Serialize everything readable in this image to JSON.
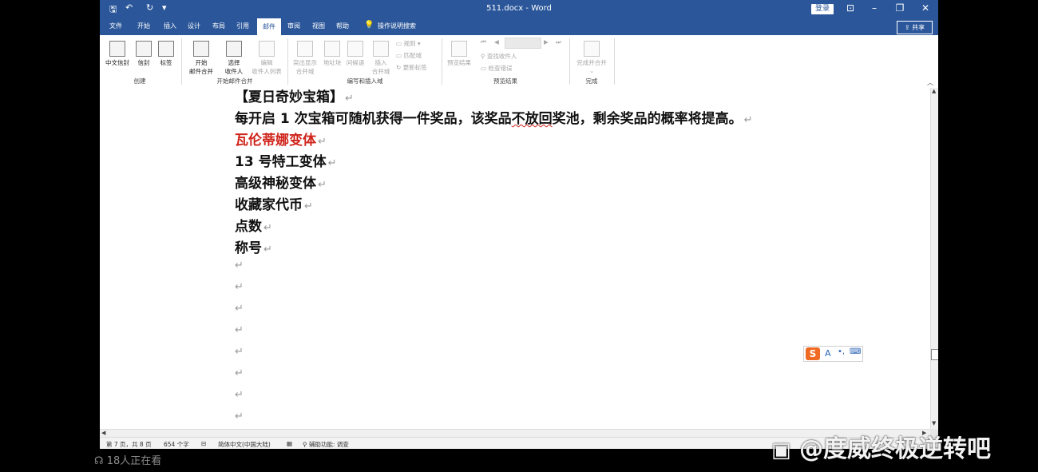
{
  "titlebar": {
    "doc_title": "511.docx - Word",
    "login": "登录",
    "qat_save": "🖫",
    "qat_undo": "↶",
    "qat_redo": "↻",
    "qat_more": "▾"
  },
  "tabs": [
    "文件",
    "开始",
    "插入",
    "设计",
    "布局",
    "引用",
    "邮件",
    "审阅",
    "视图",
    "帮助"
  ],
  "active_tab": "邮件",
  "tell_me": "操作说明搜索",
  "share": "共享",
  "ribbon": {
    "create": {
      "label": "创建",
      "envelope": "中文信封",
      "envelope2": "信封",
      "labels": "标签"
    },
    "start_merge": {
      "label": "开始邮件合并",
      "start": "开始",
      "start2": "邮件合并",
      "select": "选择",
      "select2": "收件人",
      "edit": "编辑",
      "edit2": "收件人列表"
    },
    "write_insert": {
      "label": "编写和插入域",
      "highlight": "突出显示",
      "highlight2": "合并域",
      "address": "地址块",
      "greeting": "问候语",
      "insert": "插入",
      "insert2": "合并域",
      "rules": "规则",
      "match": "匹配域",
      "update": "更新标签"
    },
    "preview": {
      "label": "预览结果",
      "preview_btn": "预览结果",
      "find": "查找收件人",
      "check": "检查错误"
    },
    "finish": {
      "label": "完成",
      "finish_btn": "完成并合并"
    }
  },
  "document": {
    "heading": "【夏日奇妙宝箱】",
    "desc_a": "每开启 1 次宝箱可随机获得一件奖品，该奖品",
    "desc_b": "不放回",
    "desc_c": "奖池，剩余奖品的概率将提高。",
    "items": [
      {
        "text": "瓦伦蒂娜变体",
        "color": "#d0241b"
      },
      {
        "text": "13 号特工变体",
        "color": "#111111"
      },
      {
        "text": "高级神秘变体",
        "color": "#111111"
      },
      {
        "text": "收藏家代币",
        "color": "#111111"
      },
      {
        "text": "点数",
        "color": "#111111"
      },
      {
        "text": "称号",
        "color": "#111111"
      }
    ],
    "para_mark": "↵"
  },
  "status": {
    "page": "第 7 页，共 8 页",
    "words": "654 个字",
    "language": "简体中文(中国大陆)",
    "accessibility": "辅助功能: 调查"
  },
  "ime": {
    "letter": "A"
  },
  "overlay": {
    "viewers": "18人正在看",
    "watermark": "@度威终极逆转吧"
  }
}
